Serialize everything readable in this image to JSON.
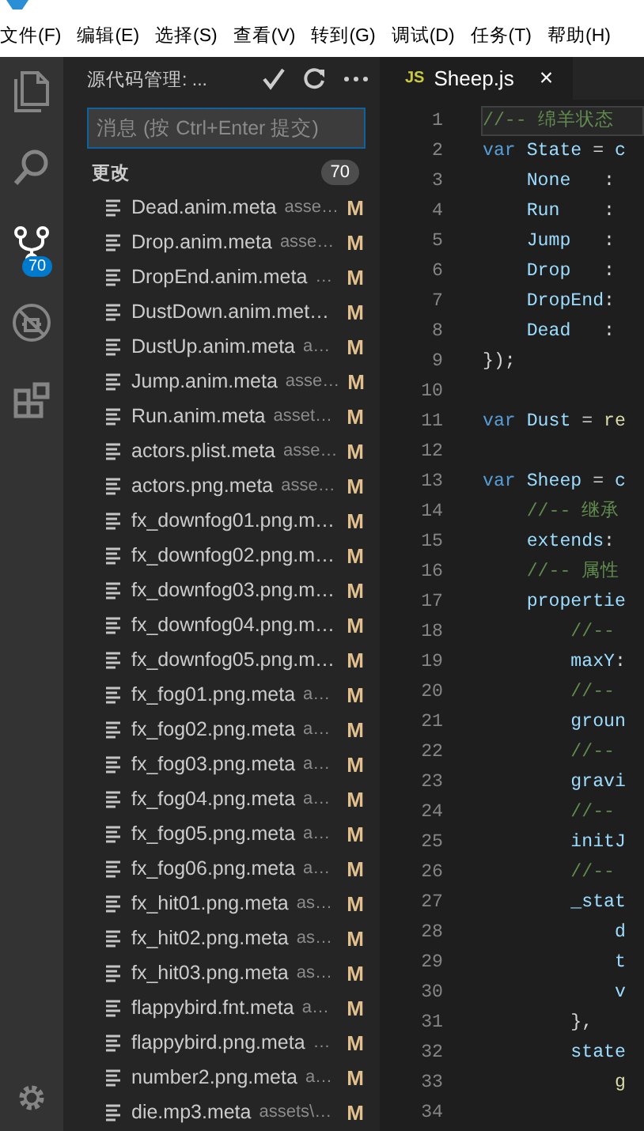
{
  "menu": [
    "文件(F)",
    "编辑(E)",
    "选择(S)",
    "查看(V)",
    "转到(G)",
    "调试(D)",
    "任务(T)",
    "帮助(H)"
  ],
  "activity_bar": [
    {
      "kind": "files",
      "selected": false
    },
    {
      "kind": "search",
      "selected": false
    },
    {
      "kind": "scm",
      "selected": true,
      "badge": "70"
    },
    {
      "kind": "debug",
      "selected": false
    },
    {
      "kind": "extensions",
      "selected": false
    }
  ],
  "sidebar": {
    "title": "源代码管理: ...",
    "commit_message": {
      "placeholder": "消息 (按 Ctrl+Enter 提交)"
    },
    "section": {
      "title": "更改",
      "count": "70"
    },
    "changes": [
      {
        "name": "Dead.anim.meta",
        "path": "asse…",
        "status": "M"
      },
      {
        "name": "Drop.anim.meta",
        "path": "asse…",
        "status": "M"
      },
      {
        "name": "DropEnd.anim.meta",
        "path": "…",
        "status": "M"
      },
      {
        "name": "DustDown.anim.met…",
        "status": "M"
      },
      {
        "name": "DustUp.anim.meta",
        "path": "a…",
        "status": "M"
      },
      {
        "name": "Jump.anim.meta",
        "path": "asse…",
        "status": "M"
      },
      {
        "name": "Run.anim.meta",
        "path": "asset…",
        "status": "M"
      },
      {
        "name": "actors.plist.meta",
        "path": "asse…",
        "status": "M"
      },
      {
        "name": "actors.png.meta",
        "path": "asse…",
        "status": "M"
      },
      {
        "name": "fx_downfog01.png.m…",
        "status": "M"
      },
      {
        "name": "fx_downfog02.png.m…",
        "status": "M"
      },
      {
        "name": "fx_downfog03.png.m…",
        "status": "M"
      },
      {
        "name": "fx_downfog04.png.m…",
        "status": "M"
      },
      {
        "name": "fx_downfog05.png.m…",
        "status": "M"
      },
      {
        "name": "fx_fog01.png.meta",
        "path": "a…",
        "status": "M"
      },
      {
        "name": "fx_fog02.png.meta",
        "path": "a…",
        "status": "M"
      },
      {
        "name": "fx_fog03.png.meta",
        "path": "a…",
        "status": "M"
      },
      {
        "name": "fx_fog04.png.meta",
        "path": "a…",
        "status": "M"
      },
      {
        "name": "fx_fog05.png.meta",
        "path": "a…",
        "status": "M"
      },
      {
        "name": "fx_fog06.png.meta",
        "path": "a…",
        "status": "M"
      },
      {
        "name": "fx_hit01.png.meta",
        "path": "as…",
        "status": "M"
      },
      {
        "name": "fx_hit02.png.meta",
        "path": "as…",
        "status": "M"
      },
      {
        "name": "fx_hit03.png.meta",
        "path": "as…",
        "status": "M"
      },
      {
        "name": "flappybird.fnt.meta",
        "path": "a…",
        "status": "M"
      },
      {
        "name": "flappybird.png.meta",
        "path": "…",
        "status": "M"
      },
      {
        "name": "number2.png.meta",
        "path": "a…",
        "status": "M"
      },
      {
        "name": "die.mp3.meta",
        "path": "assets\\…",
        "status": "M"
      }
    ]
  },
  "editor": {
    "tab": {
      "icon_text": "JS",
      "title": "Sheep.js",
      "close": "×"
    },
    "lines": [
      {
        "number": "1",
        "current": true,
        "tokens": [
          {
            "text": "//-- 绵羊状态",
            "kind": "comment"
          }
        ]
      },
      {
        "number": "2",
        "current": false,
        "tokens": [
          {
            "text": "var",
            "kind": "keyword"
          },
          {
            "text": " State",
            "kind": "ident"
          },
          {
            "text": " = ",
            "kind": "plain"
          },
          {
            "text": "c",
            "kind": "ident"
          }
        ]
      },
      {
        "number": "3",
        "current": false,
        "tokens": [
          {
            "text": "    None",
            "kind": "ident"
          },
          {
            "text": "   :",
            "kind": "plain"
          }
        ]
      },
      {
        "number": "4",
        "current": false,
        "tokens": [
          {
            "text": "    Run",
            "kind": "ident"
          },
          {
            "text": "    :",
            "kind": "plain"
          }
        ]
      },
      {
        "number": "5",
        "current": false,
        "tokens": [
          {
            "text": "    Jump",
            "kind": "ident"
          },
          {
            "text": "   :",
            "kind": "plain"
          }
        ]
      },
      {
        "number": "6",
        "current": false,
        "tokens": [
          {
            "text": "    Drop",
            "kind": "ident"
          },
          {
            "text": "   :",
            "kind": "plain"
          }
        ]
      },
      {
        "number": "7",
        "current": false,
        "tokens": [
          {
            "text": "    DropEnd",
            "kind": "ident"
          },
          {
            "text": ":",
            "kind": "plain"
          }
        ]
      },
      {
        "number": "8",
        "current": false,
        "tokens": [
          {
            "text": "    Dead",
            "kind": "ident"
          },
          {
            "text": "   :",
            "kind": "plain"
          }
        ]
      },
      {
        "number": "9",
        "current": false,
        "tokens": [
          {
            "text": "});",
            "kind": "plain"
          }
        ]
      },
      {
        "number": "10",
        "current": false
      },
      {
        "number": "11",
        "current": false,
        "tokens": [
          {
            "text": "var",
            "kind": "keyword"
          },
          {
            "text": " Dust",
            "kind": "ident"
          },
          {
            "text": " = ",
            "kind": "plain"
          },
          {
            "text": "re",
            "kind": "func"
          }
        ]
      },
      {
        "number": "12",
        "current": false
      },
      {
        "number": "13",
        "current": false,
        "tokens": [
          {
            "text": "var",
            "kind": "keyword"
          },
          {
            "text": " Sheep",
            "kind": "ident"
          },
          {
            "text": " = ",
            "kind": "plain"
          },
          {
            "text": "c",
            "kind": "ident"
          }
        ]
      },
      {
        "number": "14",
        "current": false,
        "tokens": [
          {
            "text": "    //-- 继承",
            "kind": "comment"
          }
        ]
      },
      {
        "number": "15",
        "current": false,
        "tokens": [
          {
            "text": "    extends",
            "kind": "ident"
          },
          {
            "text": ":",
            "kind": "plain"
          }
        ]
      },
      {
        "number": "16",
        "current": false,
        "tokens": [
          {
            "text": "    //-- 属性",
            "kind": "comment"
          }
        ]
      },
      {
        "number": "17",
        "current": false,
        "tokens": [
          {
            "text": "    propertie",
            "kind": "ident"
          }
        ]
      },
      {
        "number": "18",
        "current": false,
        "tokens": [
          {
            "text": "        //--",
            "kind": "comment"
          }
        ]
      },
      {
        "number": "19",
        "current": false,
        "tokens": [
          {
            "text": "        maxY",
            "kind": "ident"
          },
          {
            "text": ":",
            "kind": "plain"
          }
        ]
      },
      {
        "number": "20",
        "current": false,
        "tokens": [
          {
            "text": "        //--",
            "kind": "comment"
          }
        ]
      },
      {
        "number": "21",
        "current": false,
        "tokens": [
          {
            "text": "        groun",
            "kind": "ident"
          }
        ]
      },
      {
        "number": "22",
        "current": false,
        "tokens": [
          {
            "text": "        //--",
            "kind": "comment"
          }
        ]
      },
      {
        "number": "23",
        "current": false,
        "tokens": [
          {
            "text": "        gravi",
            "kind": "ident"
          }
        ]
      },
      {
        "number": "24",
        "current": false,
        "tokens": [
          {
            "text": "        //--",
            "kind": "comment"
          }
        ]
      },
      {
        "number": "25",
        "current": false,
        "tokens": [
          {
            "text": "        initJ",
            "kind": "ident"
          }
        ]
      },
      {
        "number": "26",
        "current": false,
        "tokens": [
          {
            "text": "        //--",
            "kind": "comment"
          }
        ]
      },
      {
        "number": "27",
        "current": false,
        "tokens": [
          {
            "text": "        _stat",
            "kind": "ident"
          }
        ]
      },
      {
        "number": "28",
        "current": false,
        "tokens": [
          {
            "text": "            d",
            "kind": "ident"
          }
        ]
      },
      {
        "number": "29",
        "current": false,
        "tokens": [
          {
            "text": "            t",
            "kind": "ident"
          }
        ]
      },
      {
        "number": "30",
        "current": false,
        "tokens": [
          {
            "text": "            v",
            "kind": "ident"
          }
        ]
      },
      {
        "number": "31",
        "current": false,
        "tokens": [
          {
            "text": "        },",
            "kind": "plain"
          }
        ]
      },
      {
        "number": "32",
        "current": false,
        "tokens": [
          {
            "text": "        state",
            "kind": "ident"
          }
        ]
      },
      {
        "number": "33",
        "current": false,
        "tokens": [
          {
            "text": "            g",
            "kind": "func"
          }
        ]
      },
      {
        "number": "34",
        "current": false
      }
    ]
  }
}
